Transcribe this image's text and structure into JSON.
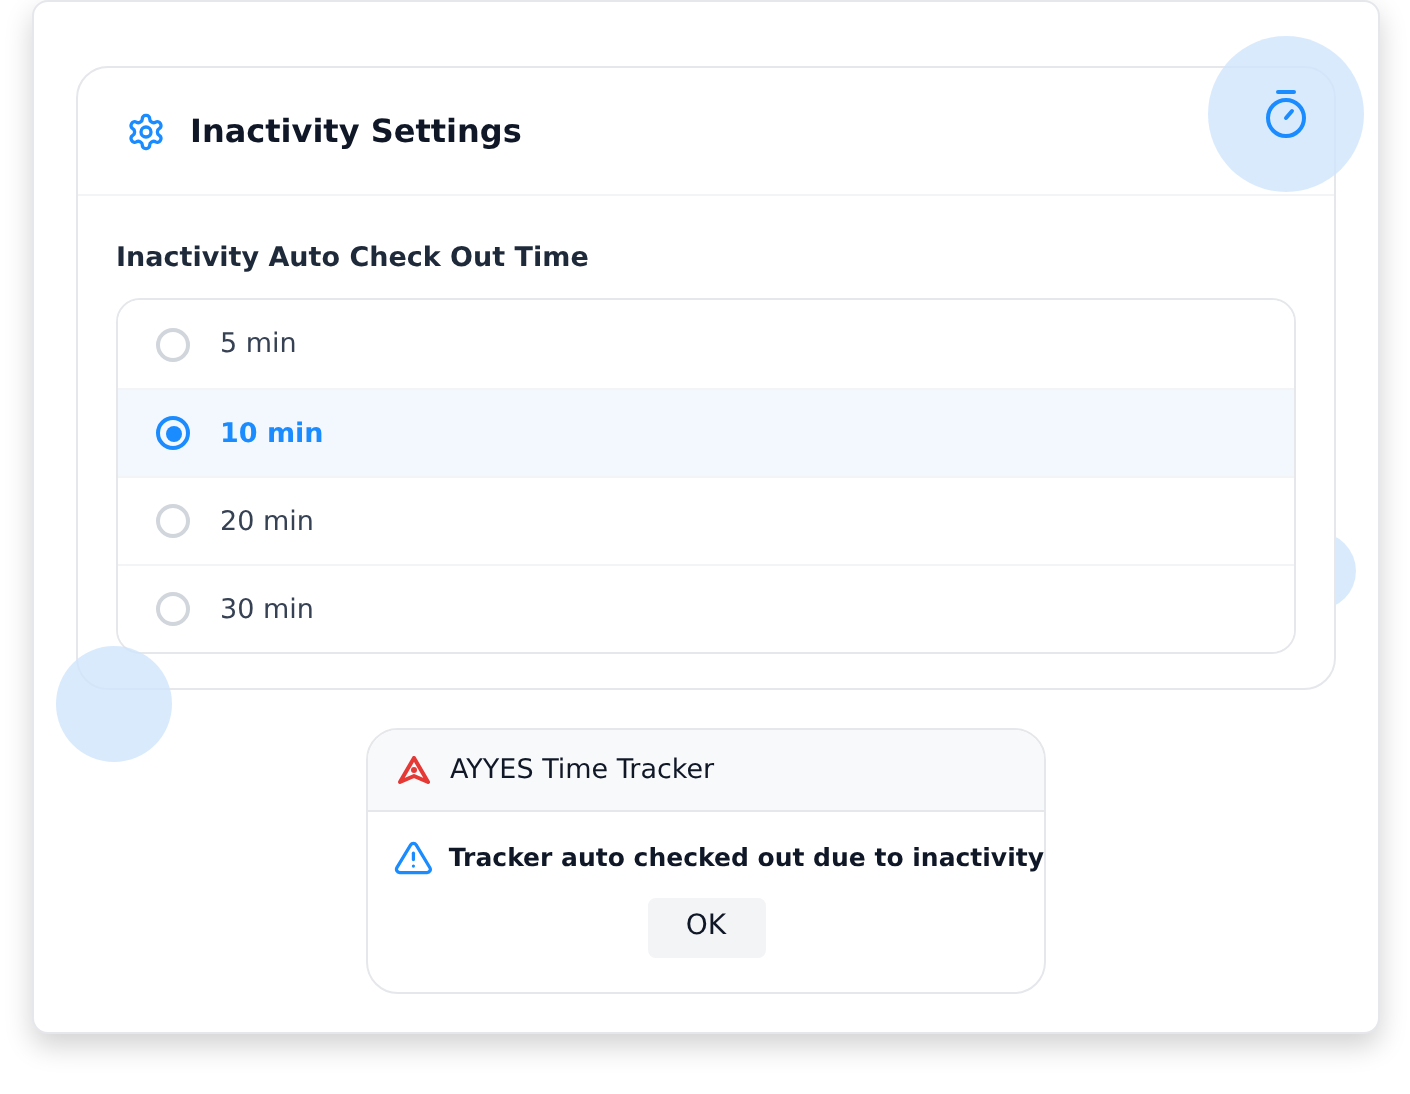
{
  "settings": {
    "title": "Inactivity Settings",
    "field_label": "Inactivity Auto Check Out Time",
    "options": [
      {
        "label": "5 min",
        "selected": false
      },
      {
        "label": "10 min",
        "selected": true
      },
      {
        "label": "20 min",
        "selected": false
      },
      {
        "label": "30 min",
        "selected": false
      }
    ]
  },
  "dialog": {
    "title": "AYYES Time Tracker",
    "message": "Tracker auto checked out due to inactivity",
    "button": "OK"
  }
}
